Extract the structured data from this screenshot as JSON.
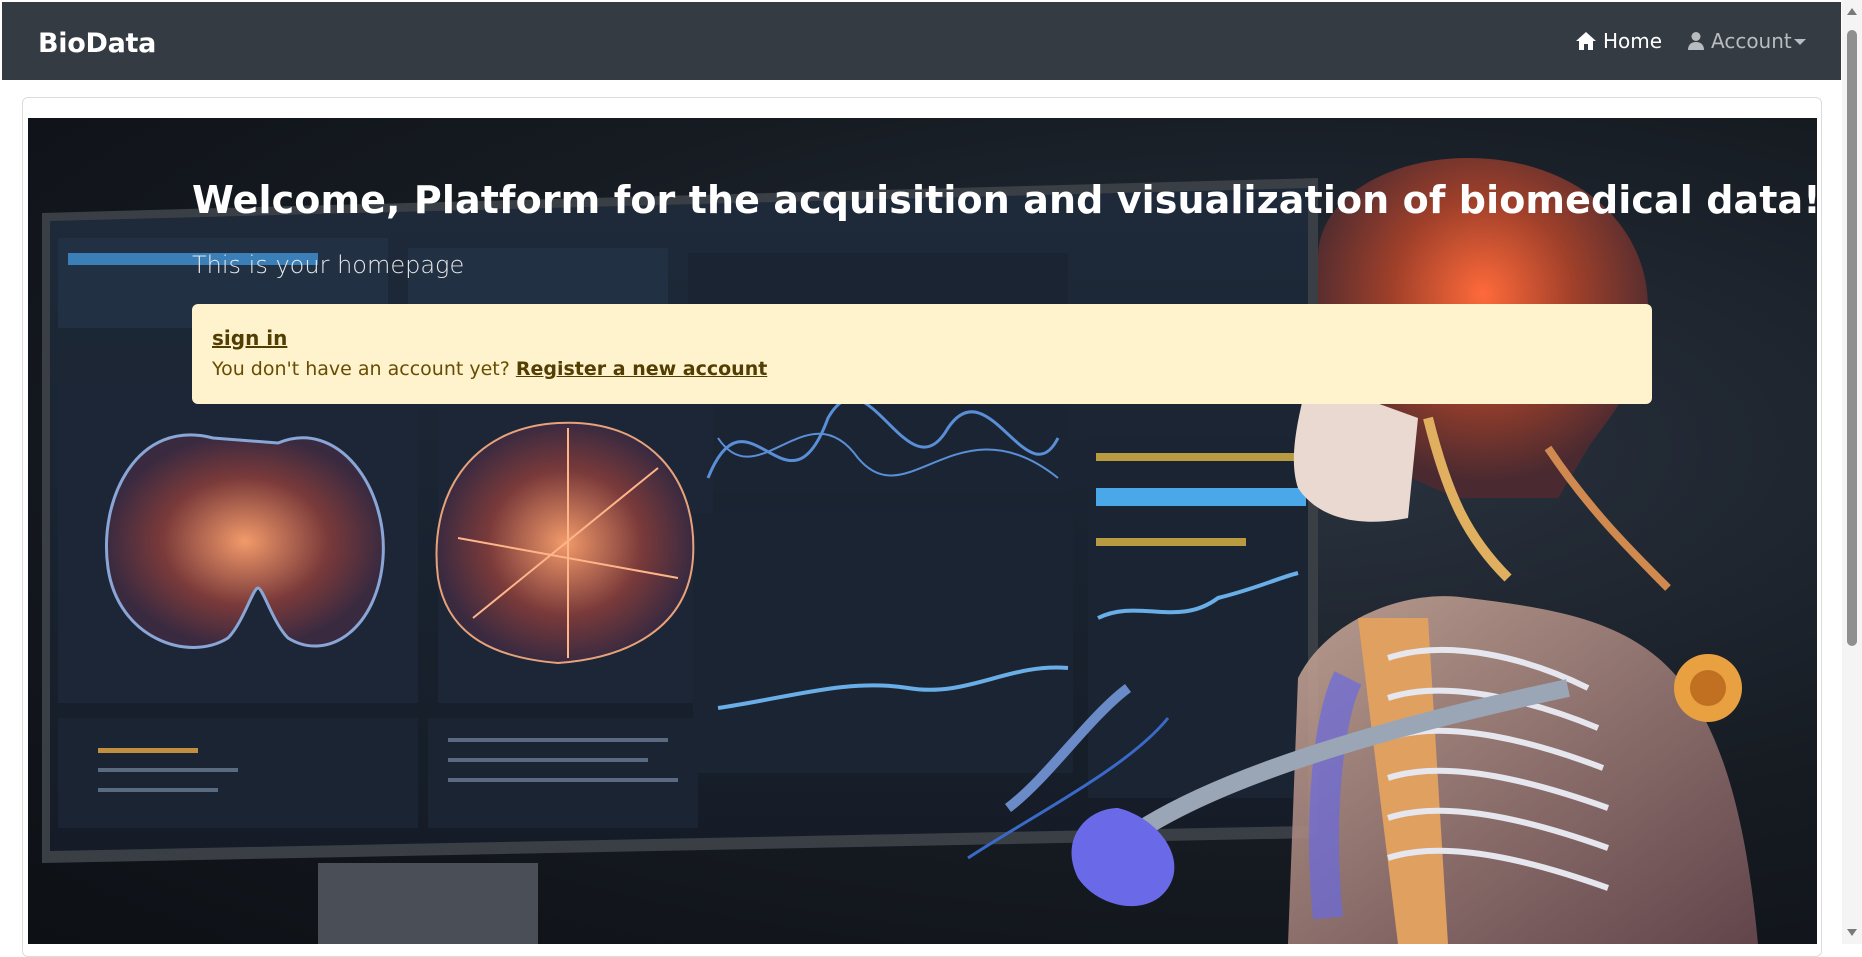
{
  "navbar": {
    "brand": "BioData",
    "home_label": "Home",
    "account_label": "Account",
    "bg_color": "#353b43"
  },
  "hero": {
    "title": "Welcome, Platform for the acquisition and visualization of biomedical data!",
    "subtitle": "This is your homepage"
  },
  "alert": {
    "sign_in_label": "sign in",
    "no_account_text": "You don't have an account yet?",
    "register_label": "Register a new account",
    "bg_color": "#fff3cd",
    "text_color": "#664d03"
  }
}
